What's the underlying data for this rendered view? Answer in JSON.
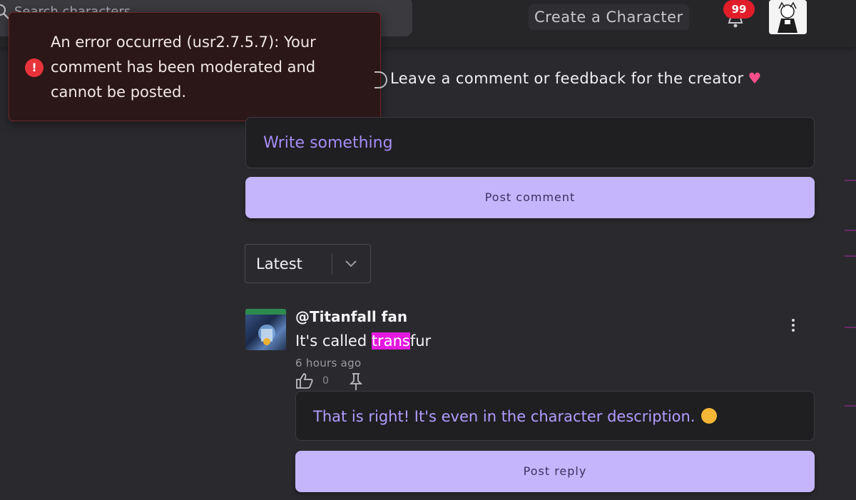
{
  "header": {
    "search_text": "Search characters...",
    "create_label": "Create a Character",
    "notification_count": "99"
  },
  "toast": {
    "message": "An error occurred (usr2.7.5.7): Your comment has been moderated and cannot be posted."
  },
  "comments_section": {
    "prompt": "Leave a comment or feedback for the creator",
    "write_value": "Write something",
    "post_button": "Post comment",
    "sort_selected": "Latest"
  },
  "comment": {
    "author": "@Titanfall fan",
    "text_before": "It's called ",
    "text_highlight": "trans",
    "text_after": "fur",
    "time": "6 hours ago",
    "like_count": "0",
    "reply_text": "That is right! It's even in the character description.",
    "reply_button": "Post reply"
  },
  "colors": {
    "accent": "#c4b5fd",
    "error": "#e8333a",
    "highlight": "#e419e0",
    "badge": "#e11d2a"
  }
}
